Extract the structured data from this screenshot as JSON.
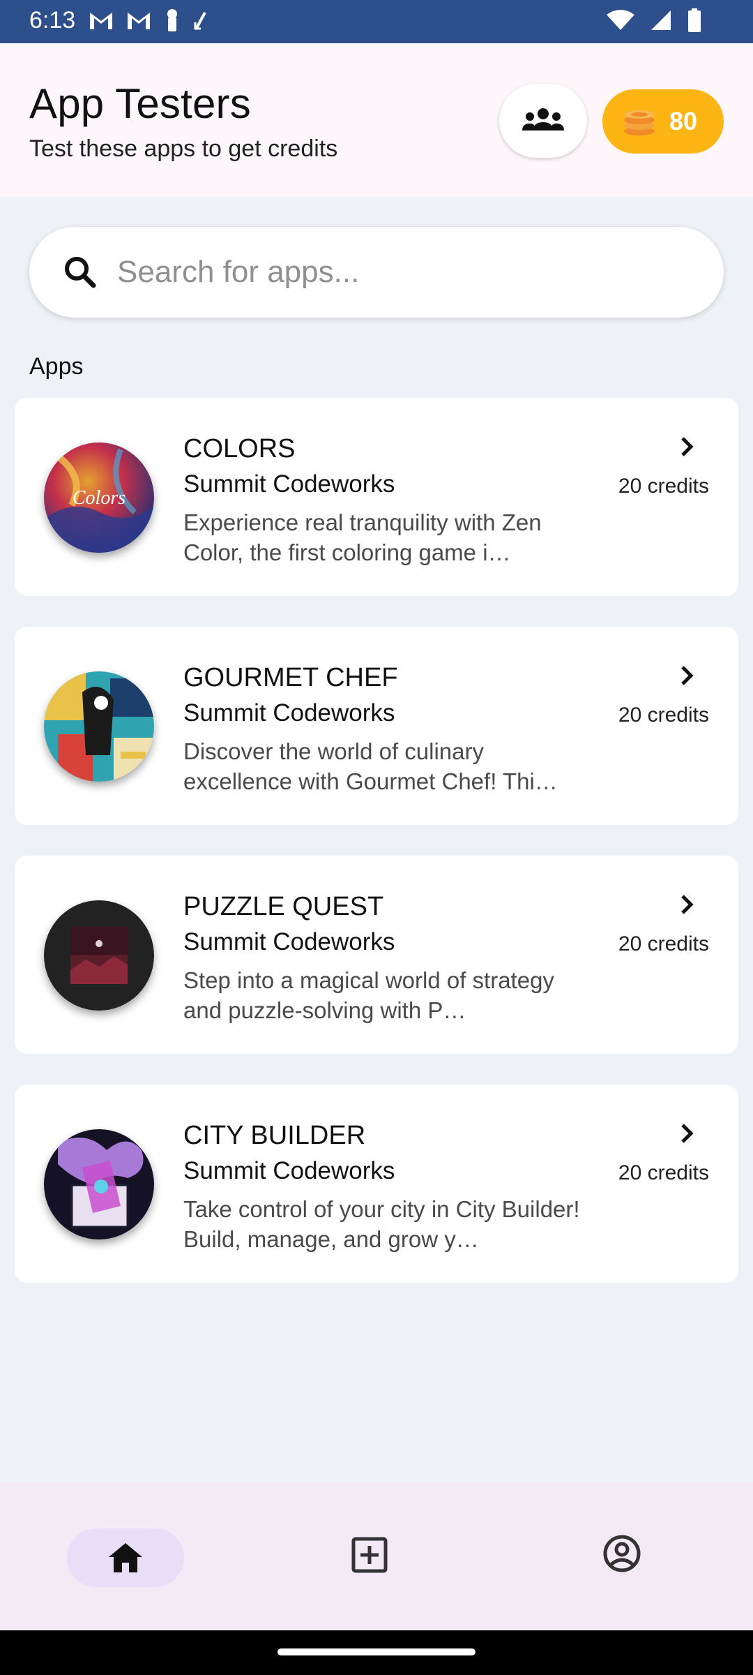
{
  "status_bar": {
    "time": "6:13",
    "left_icons": [
      "gmail-icon",
      "gmail-icon",
      "key-icon",
      "sync-icon"
    ],
    "right_icons": [
      "wifi-icon",
      "signal-icon",
      "battery-icon"
    ]
  },
  "header": {
    "title": "App Testers",
    "subtitle": "Test these apps to get credits",
    "group_icon": "group-icon",
    "credits_icon": "coins-icon",
    "credits_count": "80"
  },
  "search": {
    "placeholder": "Search for apps..."
  },
  "section": {
    "label": "Apps"
  },
  "apps": [
    {
      "name": "COLORS",
      "developer": "Summit Codeworks",
      "description": "Experience real tranquility with Zen Color, the first coloring game i…",
      "credits": "20 credits"
    },
    {
      "name": "GOURMET CHEF",
      "developer": "Summit Codeworks",
      "description": "Discover the world of culinary excellence with Gourmet Chef! Thi…",
      "credits": "20 credits"
    },
    {
      "name": "PUZZLE QUEST",
      "developer": "Summit Codeworks",
      "description": "Step into a magical world of strategy and puzzle-solving with P…",
      "credits": "20 credits"
    },
    {
      "name": "CITY BUILDER",
      "developer": "Summit Codeworks",
      "description": "Take control of your city in City Builder! Build, manage, and grow y…",
      "credits": "20 credits"
    }
  ],
  "bottom_nav": {
    "items": [
      {
        "icon": "home-icon",
        "active": true
      },
      {
        "icon": "add-box-icon",
        "active": false
      },
      {
        "icon": "account-circle-icon",
        "active": false
      }
    ]
  },
  "colors": {
    "status_bar": "#2d4f8c",
    "credits_pill": "#fdb515",
    "active_nav": "#e8def8",
    "background": "#eef1f6"
  }
}
